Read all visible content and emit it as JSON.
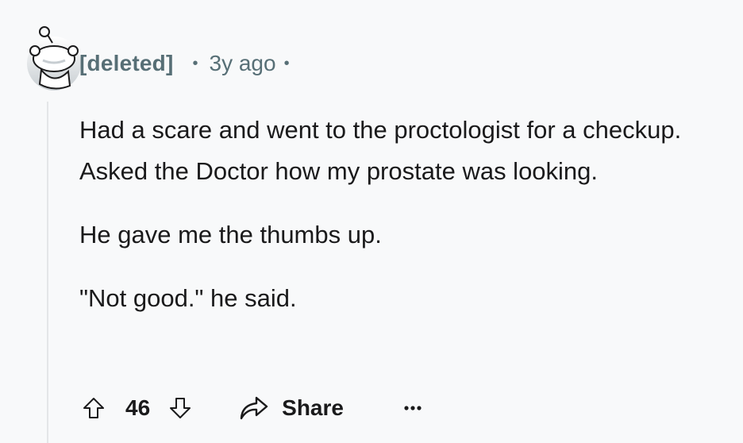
{
  "comment": {
    "author": "[deleted]",
    "separator": "•",
    "time": "3y ago",
    "paragraphs": [
      "Had a scare and went to the proctologist for a checkup. Asked the Doctor how my prostate was looking.",
      "He gave me the thumbs up.",
      "\"Not good.\" he said."
    ],
    "score": "46",
    "share_label": "Share"
  },
  "icons": {
    "avatar": "snoo-avatar-icon",
    "upvote": "upvote-arrow-icon",
    "downvote": "downvote-arrow-icon",
    "share": "share-arrow-icon",
    "more": "more-options-icon"
  },
  "colors": {
    "background": "#f8f9fa",
    "meta_text": "#576f76",
    "body_text": "#1a1a1b",
    "thread_line": "#e4e6e8"
  }
}
